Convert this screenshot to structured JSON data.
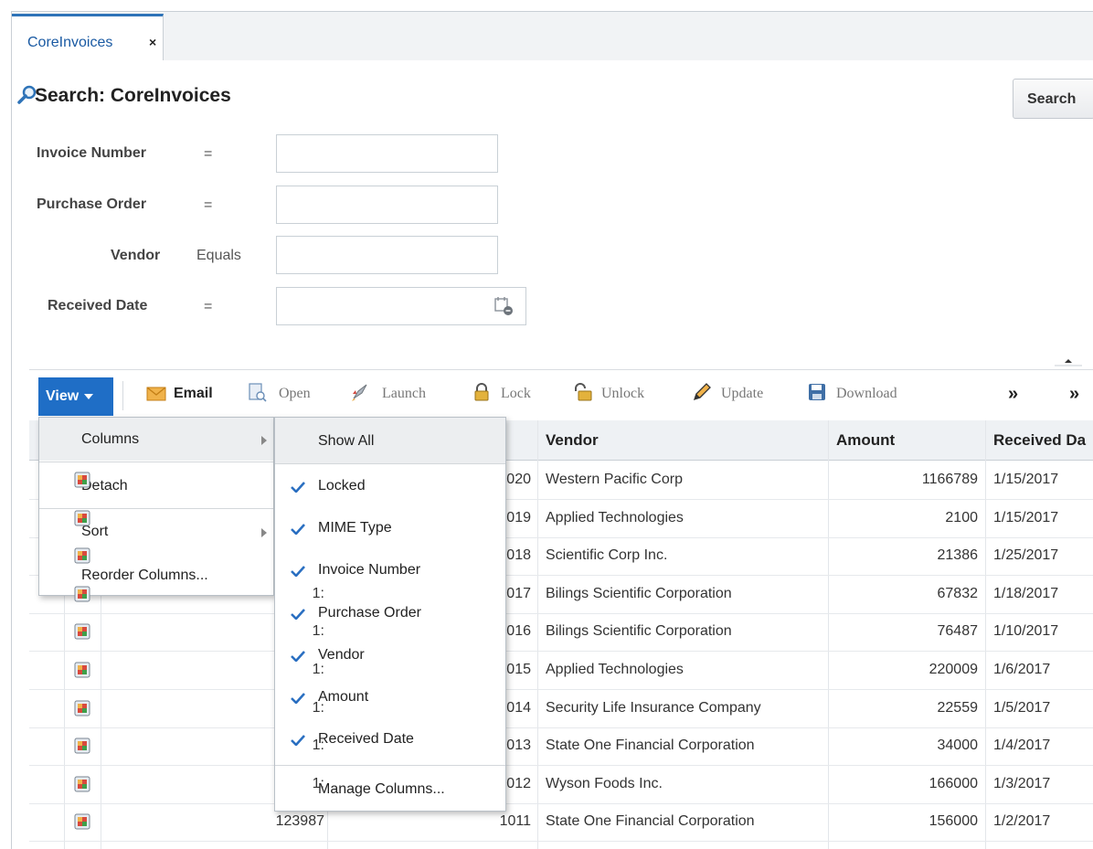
{
  "tab": {
    "label": "CoreInvoices",
    "close": "×"
  },
  "search": {
    "title": "Search: CoreInvoices",
    "button": "Search",
    "fields": [
      {
        "label": "Invoice Number",
        "operator": "=",
        "value": ""
      },
      {
        "label": "Purchase Order",
        "operator": "=",
        "value": ""
      },
      {
        "label": "Vendor",
        "operator": "Equals",
        "value": ""
      },
      {
        "label": "Received Date",
        "operator": "=",
        "value": ""
      }
    ]
  },
  "toolbar": {
    "view": "View",
    "email": "Email",
    "open": "Open",
    "launch": "Launch",
    "lock": "Lock",
    "unlock": "Unlock",
    "update": "Update",
    "download": "Download",
    "more1": "»",
    "more2": "»"
  },
  "table": {
    "headers": {
      "vendor": "Vendor",
      "amount": "Amount",
      "received": "Received Da"
    },
    "rows": [
      {
        "inv": "",
        "po": "020",
        "vendor": "Western Pacific Corp",
        "amount": "1166789",
        "date": "1/15/2017"
      },
      {
        "inv": "",
        "po": "019",
        "vendor": "Applied Technologies",
        "amount": "2100",
        "date": "1/15/2017"
      },
      {
        "inv": "",
        "po": "018",
        "vendor": "Scientific Corp Inc.",
        "amount": "21386",
        "date": "1/25/2017"
      },
      {
        "inv": "1:",
        "po": "017",
        "vendor": "Bilings Scientific Corporation",
        "amount": "67832",
        "date": "1/18/2017"
      },
      {
        "inv": "1:",
        "po": "016",
        "vendor": "Bilings Scientific Corporation",
        "amount": "76487",
        "date": "1/10/2017"
      },
      {
        "inv": "1:",
        "po": "015",
        "vendor": "Applied Technologies",
        "amount": "220009",
        "date": "1/6/2017"
      },
      {
        "inv": "1:",
        "po": "014",
        "vendor": "Security Life Insurance Company",
        "amount": "22559",
        "date": "1/5/2017"
      },
      {
        "inv": "1:",
        "po": "013",
        "vendor": "State One Financial Corporation",
        "amount": "34000",
        "date": "1/4/2017"
      },
      {
        "inv": "1:",
        "po": "012",
        "vendor": "Wyson Foods Inc.",
        "amount": "166000",
        "date": "1/3/2017"
      },
      {
        "inv": "123987",
        "po": "1011",
        "vendor": "State One Financial Corporation",
        "amount": "156000",
        "date": "1/2/2017"
      }
    ]
  },
  "view_menu": {
    "items": [
      "Columns",
      "Detach",
      "Sort",
      "Reorder Columns..."
    ]
  },
  "columns_menu": {
    "show_all": "Show All",
    "columns": [
      "Locked",
      "MIME Type",
      "Invoice Number",
      "Purchase Order",
      "Vendor",
      "Amount",
      "Received Date"
    ],
    "manage": "Manage Columns..."
  },
  "colors": {
    "accent": "#1f6ec6",
    "tab_border": "#2e73b8",
    "check": "#2a6fc1"
  }
}
